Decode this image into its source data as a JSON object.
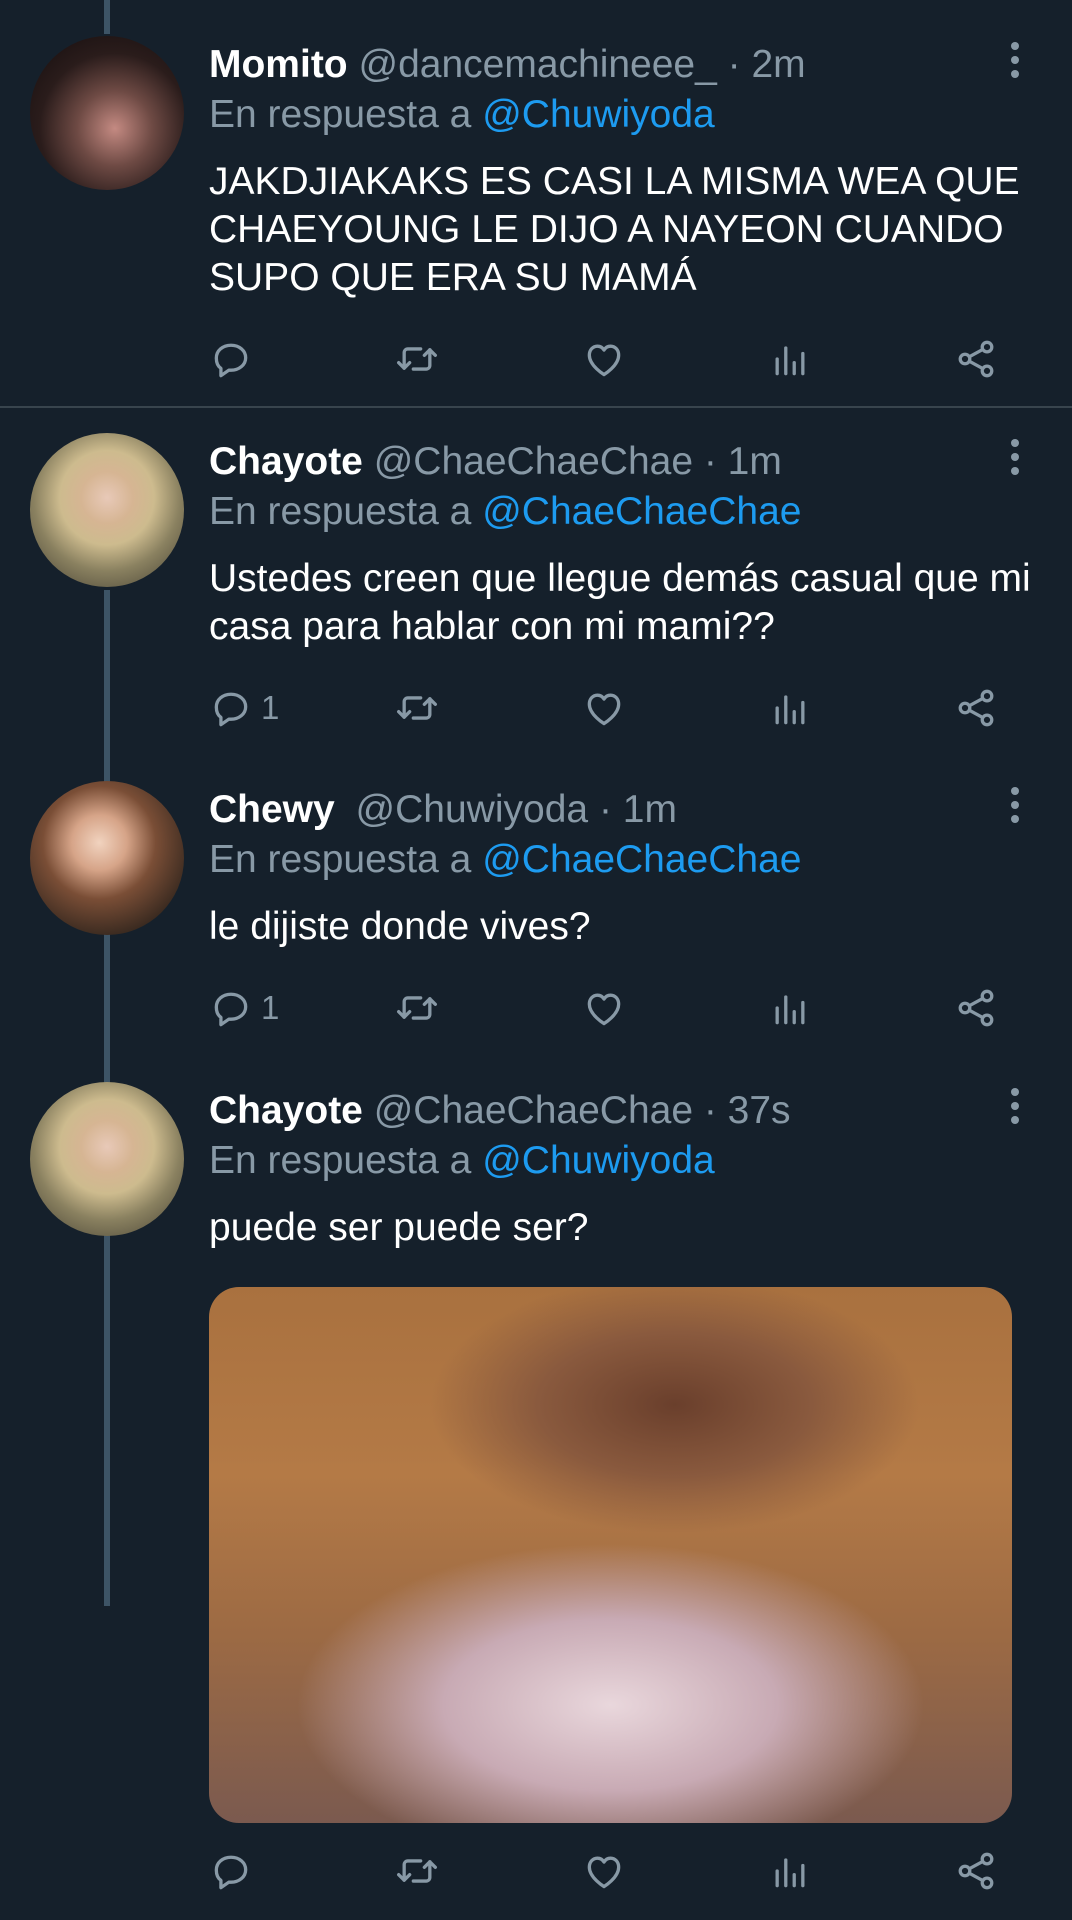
{
  "colors": {
    "background": "#15202b",
    "text": "#ffffff",
    "muted": "#8899a6",
    "accent": "#1d9bf0",
    "divider": "#38444d"
  },
  "icons": [
    "reply-icon",
    "retweet-icon",
    "like-icon",
    "analytics-icon",
    "share-icon",
    "more-icon"
  ],
  "tweets": [
    {
      "name": "Momito",
      "handle": "@dancemachineee_",
      "time": "· 2m",
      "reply_prefix": "En respuesta a",
      "reply_to": "@Chuwiyoda",
      "text": "JAKDJIAKAKS ES CASI LA MISMA WEA QUE CHAEYOUNG LE DIJO A NAYEON CUANDO SUPO QUE ERA SU MAMÁ",
      "reply_count": ""
    },
    {
      "name": "Chayote",
      "handle": "@ChaeChaeChae",
      "time": "· 1m",
      "reply_prefix": "En respuesta a",
      "reply_to": "@ChaeChaeChae",
      "text": "Ustedes creen que llegue demás casual que mi casa para hablar con mi mami??",
      "reply_count": "1"
    },
    {
      "name": "Chewy",
      "handle": "@Chuwiyoda",
      "time": "· 1m",
      "reply_prefix": "En respuesta a",
      "reply_to": "@ChaeChaeChae",
      "text": "le dijiste donde vives?",
      "reply_count": "1"
    },
    {
      "name": "Chayote",
      "handle": "@ChaeChaeChae",
      "time": "· 37s",
      "reply_prefix": "En respuesta a",
      "reply_to": "@Chuwiyoda",
      "text": "puede ser puede ser?",
      "reply_count": ""
    }
  ]
}
